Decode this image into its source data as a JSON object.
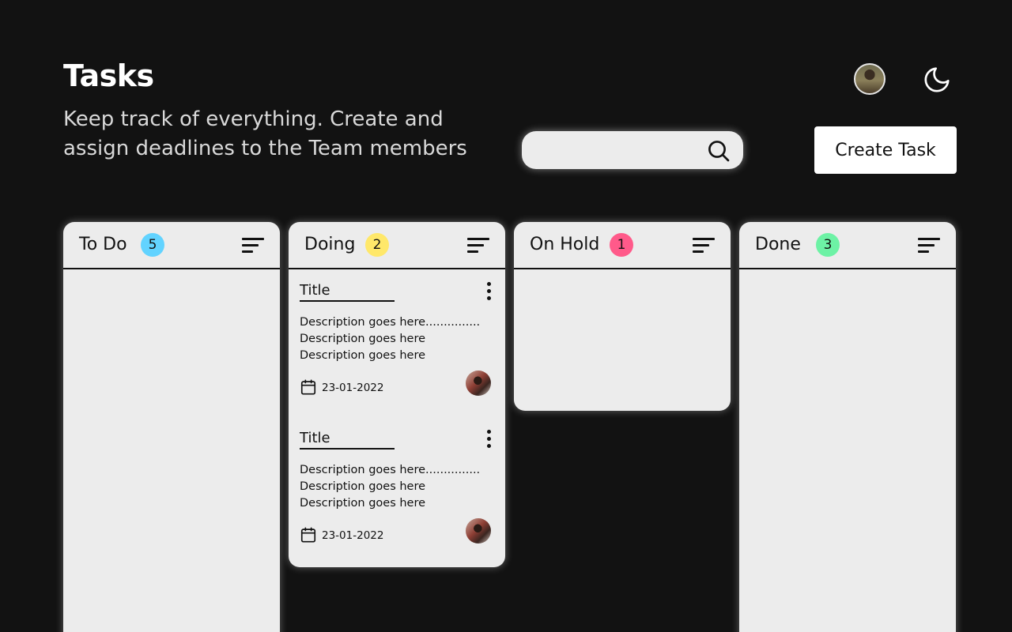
{
  "header": {
    "title": "Tasks",
    "subtitle": "Keep track of everything. Create and assign deadlines to the Team members"
  },
  "search": {
    "placeholder": ""
  },
  "actions": {
    "create_task": "Create Task"
  },
  "colors": {
    "background": "#121212",
    "column": "#ececec",
    "todo_badge": "#62d3ff",
    "doing_badge": "#ffe86a",
    "onhold_badge": "#ff5a8a",
    "done_badge": "#6df2a5"
  },
  "columns": [
    {
      "title": "To Do",
      "count": "5"
    },
    {
      "title": "Doing",
      "count": "2"
    },
    {
      "title": "On Hold",
      "count": "1"
    },
    {
      "title": "Done",
      "count": "3"
    }
  ],
  "cards": [
    {
      "title": "Title",
      "description": [
        "Description goes here...............",
        "Description goes here",
        "Description goes here"
      ],
      "date": "23-01-2022"
    },
    {
      "title": "Title",
      "description": [
        "Description goes here...............",
        "Description goes here",
        "Description goes here"
      ],
      "date": "23-01-2022"
    }
  ],
  "icons": [
    "moon-icon",
    "search-icon",
    "sort-icon",
    "more-vertical-icon",
    "calendar-icon"
  ]
}
